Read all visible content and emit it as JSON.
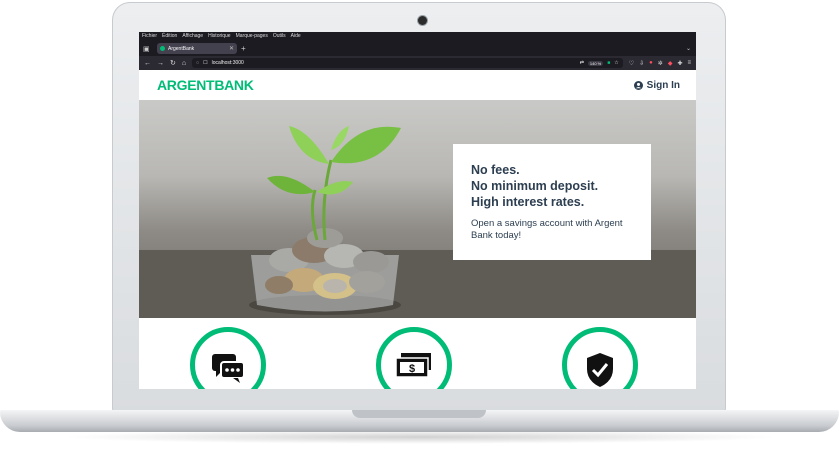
{
  "browser": {
    "menu": [
      "Fichier",
      "Édition",
      "Affichage",
      "Historique",
      "Marque-pages",
      "Outils",
      "Aide"
    ],
    "tab_title": "ArgentBank",
    "url": "localhost:3000",
    "zoom": "140 %",
    "icons": [
      "tab-list-icon",
      "back-icon",
      "forward-icon",
      "reload-icon",
      "home-icon",
      "shield-icon",
      "lock-icon",
      "translate-icon",
      "bookmark-star-icon",
      "extensions-icon",
      "menu-icon"
    ]
  },
  "site": {
    "logo_part1": "ARGENT",
    "logo_part2": "BANK",
    "signin_label": "Sign In",
    "accent": "#00bc77",
    "text_color": "#2c3e50"
  },
  "hero": {
    "subtitle1": "No fees.",
    "subtitle2": "No minimum deposit.",
    "subtitle3": "High interest rates.",
    "text": "Open a savings account with Argent Bank today!"
  },
  "features": {
    "icons": [
      "chat-icon",
      "money-icon",
      "security-icon"
    ]
  }
}
